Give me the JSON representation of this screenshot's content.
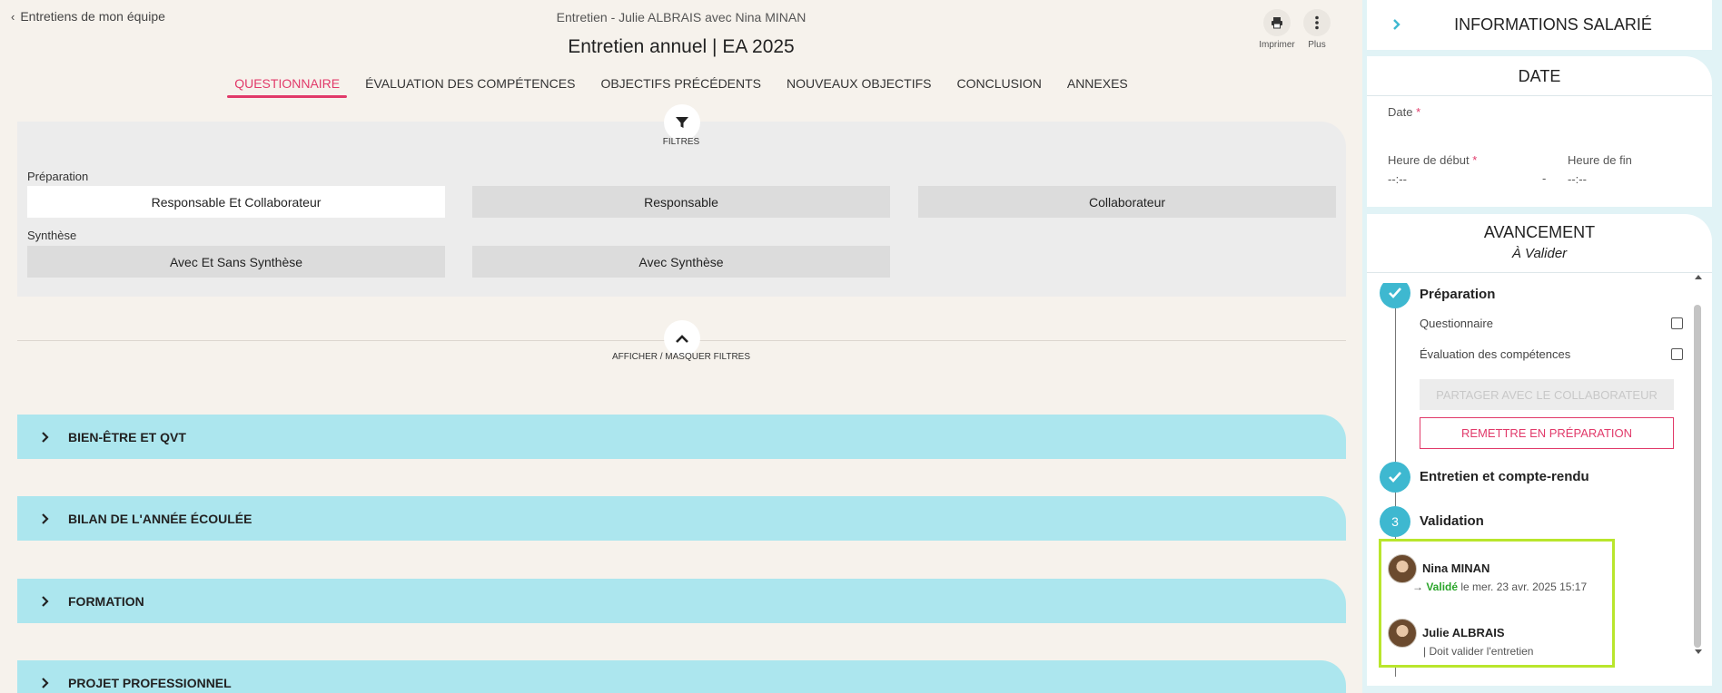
{
  "header": {
    "back_label": "Entretiens de mon équipe",
    "subtitle": "Entretien - Julie ALBRAIS avec Nina MINAN",
    "title": "Entretien annuel | EA 2025",
    "print_label": "Imprimer",
    "more_label": "Plus"
  },
  "tabs": [
    {
      "label": "QUESTIONNAIRE",
      "active": true
    },
    {
      "label": "ÉVALUATION DES COMPÉTENCES",
      "active": false
    },
    {
      "label": "OBJECTIFS PRÉCÉDENTS",
      "active": false
    },
    {
      "label": "NOUVEAUX OBJECTIFS",
      "active": false
    },
    {
      "label": "CONCLUSION",
      "active": false
    },
    {
      "label": "ANNEXES",
      "active": false
    }
  ],
  "filters": {
    "button_label": "FILTRES",
    "toggle_label": "AFFICHER / MASQUER FILTRES",
    "preparation": {
      "label": "Préparation",
      "options": [
        "Responsable Et Collaborateur",
        "Responsable",
        "Collaborateur"
      ],
      "selected": "Responsable Et Collaborateur"
    },
    "synthese": {
      "label": "Synthèse",
      "options": [
        "Avec Et Sans Synthèse",
        "Avec Synthèse"
      ]
    }
  },
  "sections": [
    {
      "title": "BIEN-ÊTRE ET QVT"
    },
    {
      "title": "BILAN DE L'ANNÉE ÉCOULÉE"
    },
    {
      "title": "FORMATION"
    },
    {
      "title": "PROJET PROFESSIONNEL"
    }
  ],
  "sidebar": {
    "info_title": "INFORMATIONS SALARIÉ",
    "date_card": {
      "title": "DATE",
      "date_label": "Date",
      "start_label": "Heure de début",
      "end_label": "Heure de fin",
      "start_value": "--:--",
      "end_value": "--:--",
      "separator": "-",
      "required_mark": "*"
    },
    "progress": {
      "title": "AVANCEMENT",
      "status": "À Valider",
      "step1": {
        "title": "Préparation",
        "items": [
          "Questionnaire",
          "Évaluation des compétences"
        ],
        "share_button": "PARTAGER AVEC LE COLLABORATEUR",
        "reset_button": "REMETTRE EN PRÉPARATION"
      },
      "step2": {
        "title": "Entretien et compte-rendu"
      },
      "step3": {
        "number": "3",
        "title": "Validation"
      },
      "validations": [
        {
          "name": "Nina MINAN",
          "arrow": "→",
          "status_word": "Validé",
          "rest": " le mer. 23 avr. 2025 15:17"
        },
        {
          "name": "Julie ALBRAIS",
          "note": "| Doit valider l'entretien"
        }
      ]
    }
  },
  "colors": {
    "accent": "#e13a6a",
    "section_bg": "#ace6ee",
    "step": "#3eb8d0",
    "highlight": "#b9e62c",
    "valid": "#2aa52a"
  }
}
